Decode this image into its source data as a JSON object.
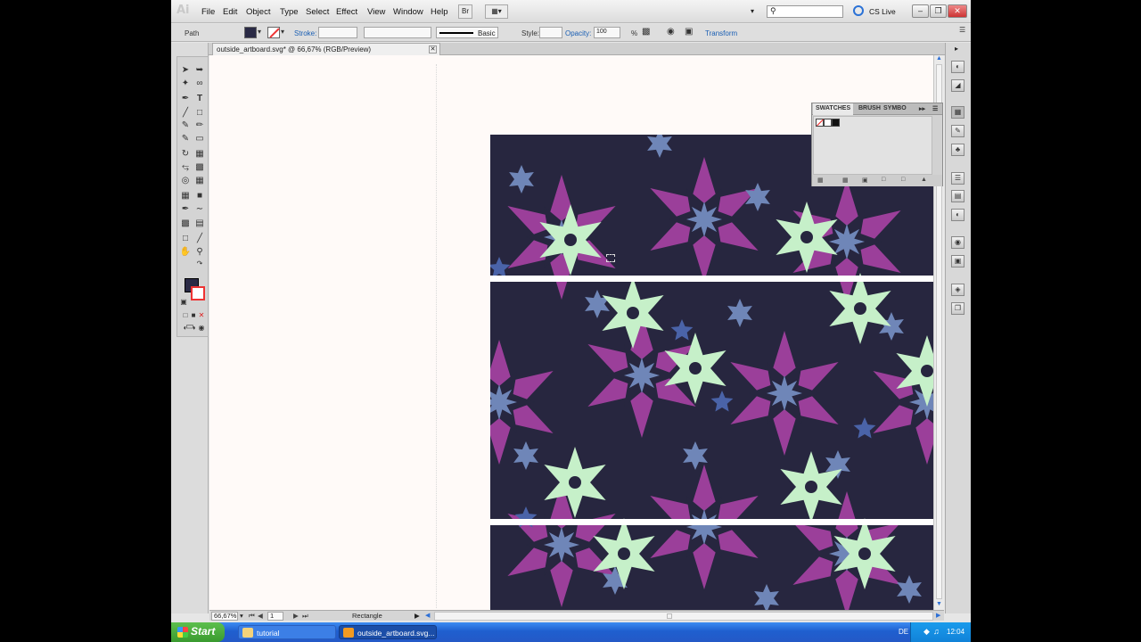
{
  "menubar": {
    "logo": "Ai",
    "items": [
      "File",
      "Edit",
      "Object",
      "Type",
      "Select",
      "Effect",
      "View",
      "Window",
      "Help"
    ],
    "bridge_label": "Br",
    "cs_live": "CS Live"
  },
  "controlbar": {
    "selection_type": "Path",
    "stroke_label": "Stroke:",
    "stroke_brush": "Basic",
    "style_label": "Style:",
    "opacity_label": "Opacity:",
    "opacity_value": "100",
    "opacity_unit": "%",
    "transform_link": "Transform",
    "fill_color": "#2a2a45"
  },
  "document": {
    "tab_title": "outside_artboard.svg* @ 66,67% (RGB/Preview)"
  },
  "statusbar": {
    "zoom": "66,67%",
    "artboard_number": "1",
    "current_tool": "Rectangle"
  },
  "swatches_panel": {
    "tabs": [
      "SWATCHES",
      "BRUSH",
      "SYMBO"
    ],
    "swatch_colors": [
      "none",
      "#ffffff",
      "#111111"
    ]
  },
  "pattern": {
    "background": "#27263f",
    "accent_colors": [
      "#9b3f9a",
      "#6f86b8",
      "#c6f0c9",
      "#4a63a8"
    ]
  },
  "taskbar": {
    "start_label": "Start",
    "items": [
      "tutorial",
      "outside_artboard.svg..."
    ],
    "language": "DE",
    "clock": "12:04"
  }
}
